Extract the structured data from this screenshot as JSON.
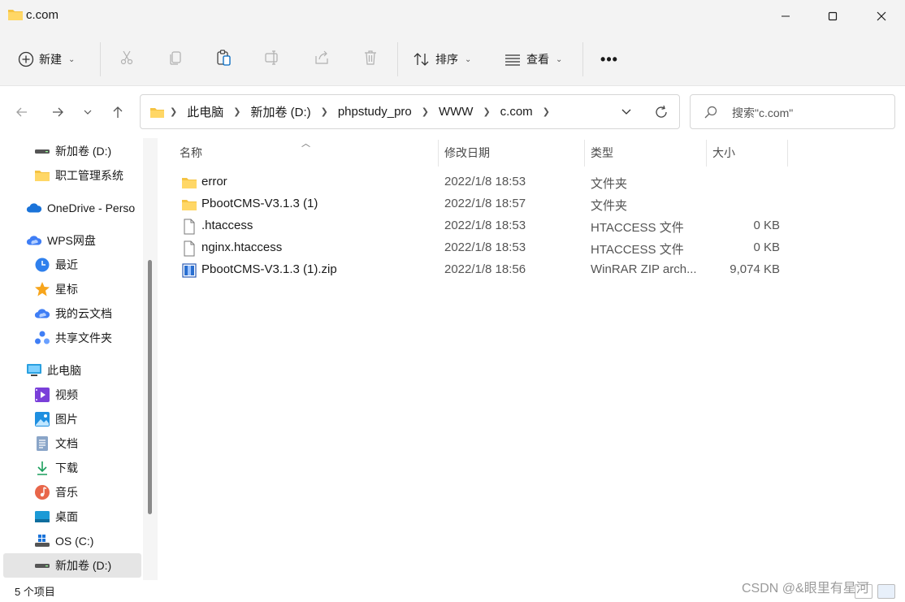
{
  "window": {
    "title": "c.com"
  },
  "toolbar": {
    "new_label": "新建",
    "sort_label": "排序",
    "view_label": "查看",
    "more_label": "•••"
  },
  "nav": {
    "breadcrumbs": [
      "此电脑",
      "新加卷 (D:)",
      "phpstudy_pro",
      "WWW",
      "c.com"
    ],
    "search_placeholder": "搜索\"c.com\""
  },
  "sidebar": {
    "items": [
      {
        "label": "新加卷 (D:)",
        "icon": "drive-icon"
      },
      {
        "label": "职工管理系统",
        "icon": "folder-icon"
      },
      {
        "label": "OneDrive - Perso",
        "icon": "onedrive-icon"
      },
      {
        "label": "WPS网盘",
        "icon": "wps-cloud-icon"
      },
      {
        "label": "最近",
        "icon": "clock-icon"
      },
      {
        "label": "星标",
        "icon": "star-icon"
      },
      {
        "label": "我的云文档",
        "icon": "cloud-doc-icon"
      },
      {
        "label": "共享文件夹",
        "icon": "share-icon"
      },
      {
        "label": "此电脑",
        "icon": "computer-icon"
      },
      {
        "label": "视频",
        "icon": "video-icon"
      },
      {
        "label": "图片",
        "icon": "picture-icon"
      },
      {
        "label": "文档",
        "icon": "document-icon"
      },
      {
        "label": "下载",
        "icon": "download-icon"
      },
      {
        "label": "音乐",
        "icon": "music-icon"
      },
      {
        "label": "桌面",
        "icon": "desktop-icon"
      },
      {
        "label": "OS (C:)",
        "icon": "windows-drive-icon"
      },
      {
        "label": "新加卷 (D:)",
        "icon": "drive-icon"
      }
    ]
  },
  "columns": {
    "name": "名称",
    "modified": "修改日期",
    "type": "类型",
    "size": "大小"
  },
  "files": [
    {
      "name": "error",
      "date": "2022/1/8 18:53",
      "type": "文件夹",
      "size": "",
      "icon": "folder-icon"
    },
    {
      "name": "PbootCMS-V3.1.3 (1)",
      "date": "2022/1/8 18:57",
      "type": "文件夹",
      "size": "",
      "icon": "folder-icon"
    },
    {
      "name": ".htaccess",
      "date": "2022/1/8 18:53",
      "type": "HTACCESS 文件",
      "size": "0 KB",
      "icon": "file-icon"
    },
    {
      "name": "nginx.htaccess",
      "date": "2022/1/8 18:53",
      "type": "HTACCESS 文件",
      "size": "0 KB",
      "icon": "file-icon"
    },
    {
      "name": "PbootCMS-V3.1.3 (1).zip",
      "date": "2022/1/8 18:56",
      "type": "WinRAR ZIP arch...",
      "size": "9,074 KB",
      "icon": "zip-icon"
    }
  ],
  "status": {
    "count": "5 个项目"
  },
  "watermark": "CSDN @&眼里有星河",
  "colors": {
    "accent": "#0067c0",
    "folder": "#f5c342",
    "chrome": "#f3f3f3"
  }
}
